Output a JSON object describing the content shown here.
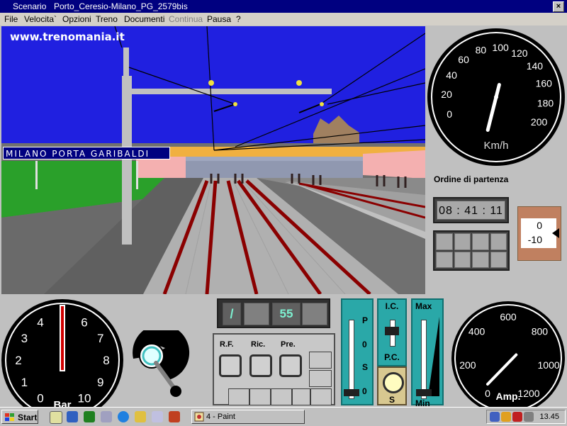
{
  "window": {
    "title_left": "Scenario",
    "title_main": "Porto_Ceresio-Milano_PG_2579bis",
    "close_label": "×"
  },
  "menu": [
    {
      "label": "File",
      "disabled": false
    },
    {
      "label": "Velocita`",
      "disabled": false
    },
    {
      "label": "Opzioni",
      "disabled": false
    },
    {
      "label": "Treno",
      "disabled": false
    },
    {
      "label": "Documenti",
      "disabled": false
    },
    {
      "label": "Continua",
      "disabled": true
    },
    {
      "label": "Pausa",
      "disabled": false
    },
    {
      "label": "?",
      "disabled": false
    }
  ],
  "view": {
    "watermark": "www.trenomania.it",
    "station_sign": "MILANO PORTA GARIBALDI"
  },
  "speed_gauge": {
    "ticks": [
      "0",
      "20",
      "40",
      "60",
      "80",
      "100",
      "120",
      "140",
      "160",
      "180",
      "200"
    ],
    "unit": "Km/h",
    "value": 108
  },
  "departure": {
    "label": "Ordine di partenza",
    "time": "08 : 41 : 11"
  },
  "gradient": {
    "values": [
      "0",
      "-10"
    ]
  },
  "pressure_gauge": {
    "ticks": [
      "0",
      "1",
      "2",
      "3",
      "4",
      "5",
      "6",
      "7",
      "8",
      "9",
      "10"
    ],
    "unit": "Bar",
    "value": 5
  },
  "indicator": {
    "symbol": "/",
    "number": "55"
  },
  "buttons": {
    "rf": "R.F.",
    "ric": "Ric.",
    "pre": "Pre."
  },
  "pos_panel": {
    "letters": [
      "P",
      "0",
      "S",
      "0"
    ]
  },
  "ic_panel": {
    "top": "I.C.",
    "bottom": "P.C."
  },
  "s_panel": {
    "label": "S"
  },
  "max_panel": {
    "top": "Max",
    "bottom": "Min"
  },
  "amp_gauge": {
    "ticks": [
      "0",
      "200",
      "400",
      "600",
      "800",
      "1000",
      "1200"
    ],
    "unit": "Amp.",
    "value": 600
  },
  "taskbar": {
    "start": "Start",
    "task": "4 - Paint",
    "time": "13.45"
  },
  "colors": {
    "sky": "#2020e0",
    "teal": "#2aa8a8",
    "title": "#000080"
  }
}
